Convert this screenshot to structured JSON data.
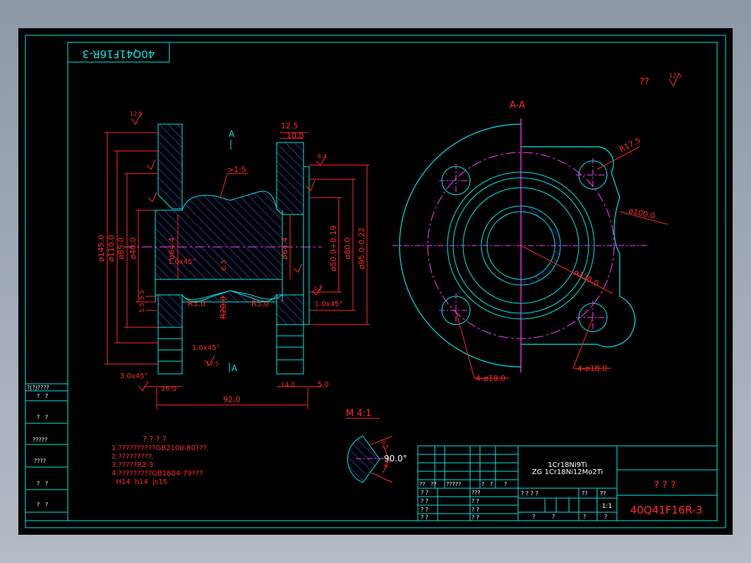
{
  "drawing": {
    "mirror_title": "40Q41F16R-3",
    "section_label": "A-A",
    "cut_mark": "A",
    "detail_label": "M 4:1",
    "corner_roughness_q": "??",
    "roughness": {
      "r125": "12.5",
      "r63": "6.3",
      "r32": "3.2"
    },
    "dims": {
      "d145": "ø145.0",
      "d110": "ø110.0",
      "d85": "ø85.0",
      "d40": "ø40.0",
      "d644a": "ø64.4",
      "d644b": "ø64.4",
      "d50": "ø50.0+0.19",
      "d80": "ø80.0",
      "d95": "ø95.0-0.22",
      "taper": ">1:5",
      "c1a": "1.0x45°",
      "c1b": "1.0x45°",
      "c1c": "1.0x45°",
      "c3": "3.0x45°",
      "r5a": "R5.0",
      "r5b": "R5.0",
      "r20": "R20.0",
      "h65": "6.5",
      "s55a": "5.5",
      "s55b": "5.5",
      "w125": "12.5",
      "w10": "10.0",
      "w16": "16.0",
      "w14": "14.0",
      "w5": "5.0",
      "len92": "92.0",
      "r175": "R17.5",
      "p100": "ø100.0",
      "p120": "ø120.0",
      "holes_left": "4-ø18.0",
      "holes_right": "4-ø18.0",
      "angle": "90.0°",
      "det_a": "0.5",
      "det_b": "1.5"
    },
    "notes": {
      "title": "? ? ? ?",
      "lines": [
        "1.??????????GB2100-80???.",
        "2.?????????.",
        "3.?????R2-3",
        "4.?????????GB1804-79???",
        "  H14  h14  js15"
      ]
    }
  },
  "left_table": {
    "header": "?(?)????",
    "rows": [
      "?   ?",
      "?   ?",
      "?????",
      "????",
      "?   ?",
      "?   ?"
    ]
  },
  "title_block": {
    "material1": "1Cr18Ni9Ti",
    "material2": "ZG 1Cr18Ni12Mo2Ti",
    "part_name": "? ? ?",
    "drawing_no": "40Q41F16R-3",
    "scale": "1:1",
    "hdr": [
      "??",
      "??",
      "?????",
      "?",
      "?",
      "?"
    ],
    "row_labels": [
      "? ?",
      "? ?",
      "? ?",
      "? ?"
    ],
    "mid_labels": [
      "???",
      "? ?",
      "? ?",
      "? ?"
    ],
    "grid_labels": [
      "? ? ? ?",
      "??",
      "??"
    ],
    "bottom_labels": [
      "?",
      "?",
      "?",
      "?"
    ]
  },
  "colors": {
    "frame": "#00e6e6",
    "dimension": "#ff2a2a",
    "centerline": "#ff40ff",
    "hatch": "#3a5aff",
    "text": "#ffffff"
  }
}
